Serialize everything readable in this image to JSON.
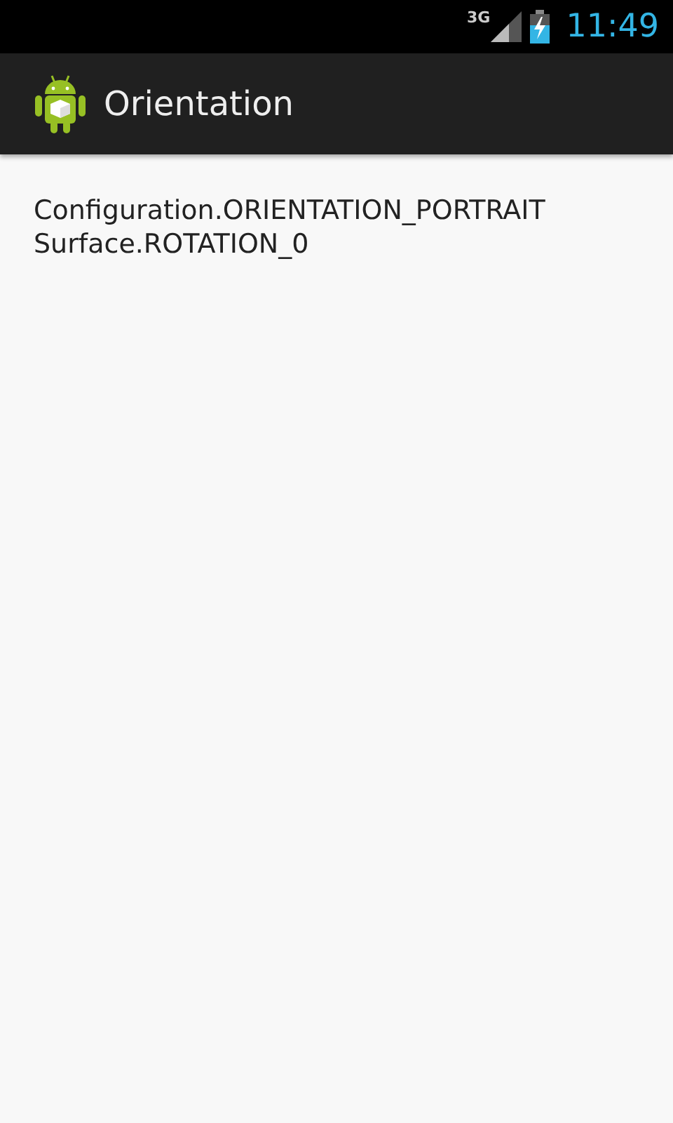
{
  "status_bar": {
    "network": "3G",
    "time": "11:49"
  },
  "action_bar": {
    "title": "Orientation"
  },
  "content": {
    "lines": [
      "Configuration.ORIENTATION_PORTRAIT",
      "Surface.ROTATION_0"
    ]
  }
}
